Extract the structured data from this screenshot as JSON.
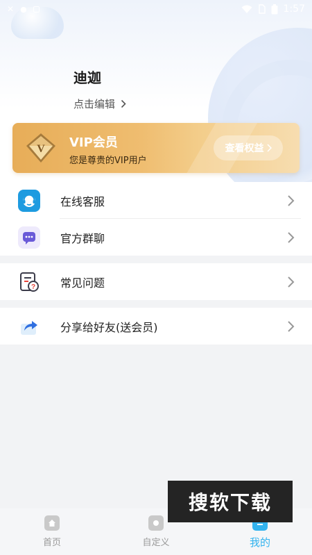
{
  "status_bar": {
    "time": "1:57"
  },
  "profile": {
    "name": "迪迦",
    "edit_label": "点击编辑"
  },
  "vip": {
    "title": "VIP会员",
    "subtitle": "您是尊贵的VIP用户",
    "badge_letter": "V",
    "button_label": "查看权益"
  },
  "menu": {
    "group1": [
      {
        "label": "在线客服",
        "icon": "headset-icon"
      },
      {
        "label": "官方群聊",
        "icon": "chat-bubble-icon"
      }
    ],
    "group2": [
      {
        "label": "常见问题",
        "icon": "faq-document-icon"
      }
    ],
    "group3": [
      {
        "label": "分享给好友(送会员)",
        "icon": "share-icon"
      }
    ]
  },
  "watermark": {
    "text": "搜软下载"
  },
  "tabbar": {
    "items": [
      {
        "label": "首页",
        "active": false
      },
      {
        "label": "自定义",
        "active": false
      },
      {
        "label": "我的",
        "active": true
      }
    ]
  },
  "colors": {
    "accent": "#33b3ee",
    "vip_gold": "#e7ad58",
    "background": "#f2f3f5"
  }
}
